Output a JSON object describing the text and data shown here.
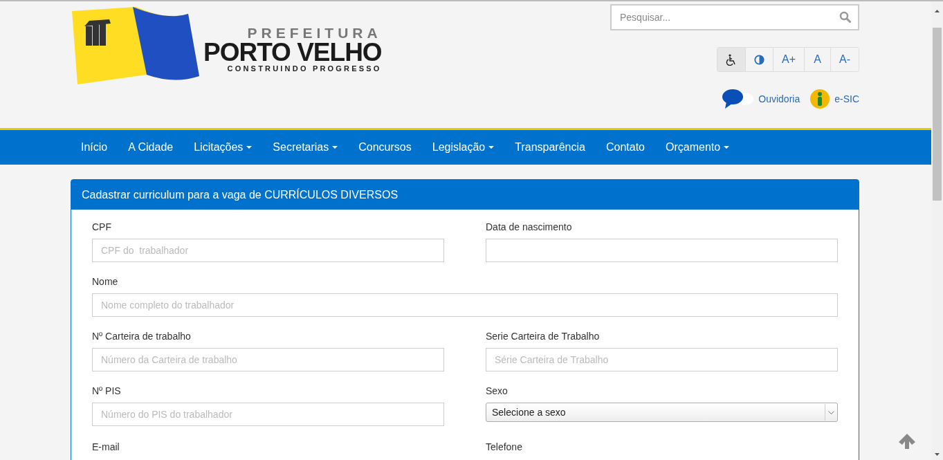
{
  "logo": {
    "line1": "PREFEITURA",
    "line2": "PORTO VELHO",
    "line3": "CONSTRUINDO PROGRESSO"
  },
  "search": {
    "placeholder": "Pesquisar..."
  },
  "accessibility": [
    {
      "kind": "wheelchair",
      "selected": true
    },
    {
      "kind": "contrast",
      "selected": false
    },
    {
      "kind": "text",
      "label": "A+",
      "selected": false
    },
    {
      "kind": "text",
      "label": "A",
      "selected": false
    },
    {
      "kind": "text",
      "label": "A-",
      "selected": false
    }
  ],
  "links": [
    {
      "kind": "chat",
      "label": "Ouvidoria"
    },
    {
      "kind": "info",
      "label": "e-SIC"
    }
  ],
  "nav": [
    {
      "label": "Início",
      "dropdown": false
    },
    {
      "label": "A Cidade",
      "dropdown": false
    },
    {
      "label": "Licitações",
      "dropdown": true
    },
    {
      "label": "Secretarias",
      "dropdown": true
    },
    {
      "label": "Concursos",
      "dropdown": false
    },
    {
      "label": "Legislação",
      "dropdown": true
    },
    {
      "label": "Transparência",
      "dropdown": false
    },
    {
      "label": "Contato",
      "dropdown": false
    },
    {
      "label": "Orçamento",
      "dropdown": true
    }
  ],
  "form": {
    "title": "Cadastrar curriculum para a vaga de CURRÍCULOS DIVERSOS",
    "rows": [
      [
        {
          "label": "CPF",
          "kind": "text",
          "placeholder": "CPF do  trabalhador"
        },
        {
          "label": "Data de nascimento",
          "kind": "text"
        }
      ],
      [
        {
          "label": "Nome",
          "kind": "text",
          "placeholder": "Nome completo do trabalhador"
        }
      ],
      [
        {
          "label": "Nº Carteira de trabalho",
          "kind": "text",
          "placeholder": "Número da Carteira de trabalho"
        },
        {
          "label": "Serie Carteira de Trabalho",
          "kind": "text",
          "placeholder": "Série Carteira de Trabalho"
        }
      ],
      [
        {
          "label": "Nº PIS",
          "kind": "text",
          "placeholder": "Número do PIS do trabalhador"
        },
        {
          "label": "Sexo",
          "kind": "select",
          "value": "Selecione a sexo"
        }
      ],
      [
        {
          "label": "E-mail",
          "kind": "offscreen"
        },
        {
          "label": "Telefone",
          "kind": "offscreen"
        }
      ]
    ]
  }
}
